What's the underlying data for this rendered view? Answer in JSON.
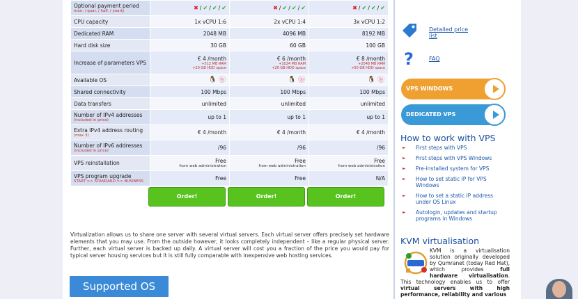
{
  "table": {
    "rows": [
      {
        "label": "Optional payment period",
        "sub": "mon. / quar. / half. / yearly",
        "type": "pay"
      },
      {
        "label": "CPU capacity",
        "values": [
          "1x vCPU 1:6",
          "2x vCPU 1:4",
          "3x vCPU 1:2"
        ]
      },
      {
        "label": "Dedicated RAM",
        "values": [
          "2048 MB",
          "4096 MB",
          "8192 MB"
        ]
      },
      {
        "label": "Hard disk size",
        "values": [
          "30 GB",
          "60 GB",
          "100 GB"
        ]
      },
      {
        "label": "Increase of parameters VPS",
        "values": [
          "€ 4 /month",
          "€ 6 /month",
          "€ 8 /month"
        ],
        "subs": [
          [
            "+512 MB RAM",
            "+20 GB HDD space"
          ],
          [
            "+1024 MB RAM",
            "+20 GB HDD space"
          ],
          [
            "+2048 MB RAM",
            "+50 GB HDD space"
          ]
        ]
      },
      {
        "label": "Available OS",
        "type": "os"
      },
      {
        "label": "Shared connectivity",
        "values": [
          "100 Mbps",
          "100 Mbps",
          "100 Mbps"
        ]
      },
      {
        "label": "Data transfers",
        "values": [
          "unlimited",
          "unlimited",
          "unlimited"
        ]
      },
      {
        "label": "Number of IPv4 addresses",
        "sub": "(included in price)",
        "values": [
          "up to 1",
          "up to 1",
          "up to 1"
        ]
      },
      {
        "label": "Extra IPv4 address routing",
        "sub": "(max 3)",
        "values": [
          "€ 4 /month",
          "€ 4 /month",
          "€ 4 /month"
        ]
      },
      {
        "label": "Number of IPv6 addresses",
        "sub": "(included in price)",
        "values": [
          "/96",
          "/96",
          "/96"
        ]
      },
      {
        "label": "VPS reinstallation",
        "values": [
          "Free",
          "Free",
          "Free"
        ],
        "subs_plain": [
          "from web administration",
          "from web administration",
          "from web administration"
        ]
      },
      {
        "label": "VPS program upgrade",
        "sub": "START >> STANDARD >> BUSINESS",
        "values": [
          "Free",
          "Free",
          "N/A"
        ]
      }
    ],
    "order_label": "Order!"
  },
  "intro": "Virtualization allows us to share one server with several virtual servers. Each virtual server offers precisely set hardware elements that you may use. From the outside however, it looks completely independent – like a regular physical server. Further, each virtual server is backed up daily. A virtual server will cost you a fraction of the price you would pay for typical server housing services but it is still fully comparable with inexpensive web hosting services.",
  "supported_os": "Supported OS",
  "sidebar": {
    "price_list": "Detailed price list",
    "faq": "FAQ",
    "vps_windows": "VPS WINDOWS",
    "dedicated_vps": "DEDICATED VPS",
    "how_title": "How to work with VPS",
    "how_items": [
      "First steps with VPS",
      "First steps with VPS Windows",
      "Pre-installed system for VPS",
      "How to set static IP for VPS Windows",
      "How to set a static IP address under OS Linux",
      "Autologin, updates and startup programs in Windows"
    ],
    "kvm_title": "KVM virtualisation",
    "kvm_a": "KVM is a virtualisation solution originally developed by Qumranet (today Red Hat), which provides ",
    "kvm_b": "full hardware virtualisation",
    "kvm_c": ". This technology enables us to offer ",
    "kvm_d": "virtual servers with high performance, reliability and various"
  },
  "colors": {
    "accent": "#1a56a8",
    "order": "#58c21e",
    "windows": "#f0a030",
    "dedicated": "#3a9ad8"
  }
}
